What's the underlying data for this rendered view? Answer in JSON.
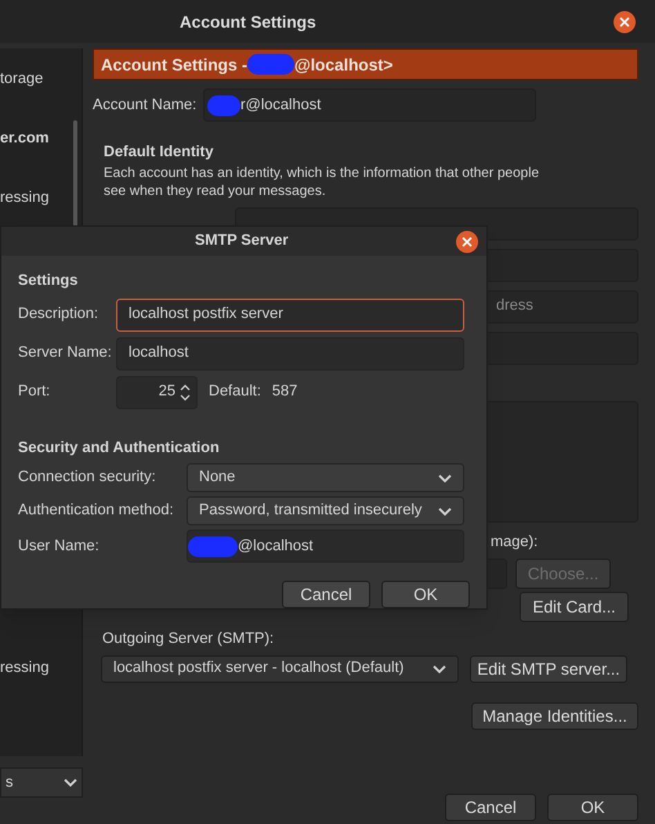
{
  "window": {
    "title": "Account Settings"
  },
  "sidebar": {
    "items": [
      {
        "label": "torage",
        "kind": "item"
      },
      {
        "label": "er.com",
        "kind": "account"
      },
      {
        "label": "ressing",
        "kind": "item"
      }
    ],
    "lower_items": [
      {
        "label": "ressing"
      }
    ],
    "dropdown": {
      "value": "s"
    }
  },
  "header": {
    "prefix": "Account Settings - ",
    "suffix": "@localhost>"
  },
  "account_name": {
    "label": "Account Name:",
    "value": "r@localhost"
  },
  "default_identity": {
    "title": "Default Identity",
    "description": "Each account has an identity, which is the information that other people see when they read your messages."
  },
  "email_field": {
    "placeholder": "dress"
  },
  "signature_image_label": "mage):",
  "choose_button": {
    "label": "Choose...",
    "disabled": true
  },
  "edit_card_button": {
    "label": "Edit Card..."
  },
  "outgoing_server": {
    "label": "Outgoing Server (SMTP):",
    "value": "localhost postfix server - localhost (Default)"
  },
  "edit_smtp_button": {
    "label": "Edit SMTP server..."
  },
  "manage_identities_button": {
    "label": "Manage Identities..."
  },
  "buttons": [
    "Cancel",
    "OK"
  ],
  "smtp_dialog": {
    "title": "SMTP Server",
    "settings_heading": "Settings",
    "description": {
      "label": "Description:",
      "value": "localhost postfix server",
      "focused": true
    },
    "server_name": {
      "label": "Server Name:",
      "value": "localhost",
      "focused": false
    },
    "port": {
      "label": "Port:",
      "value": "25",
      "default_label": "Default:",
      "default_value": "587"
    },
    "security_heading": "Security and Authentication",
    "connection_security": {
      "label": "Connection security:",
      "value": "None"
    },
    "auth_method": {
      "label": "Authentication method:",
      "value": "Password, transmitted insecurely"
    },
    "user_name": {
      "label": "User Name:",
      "value": "@localhost"
    },
    "buttons": [
      "Cancel",
      "OK"
    ]
  }
}
